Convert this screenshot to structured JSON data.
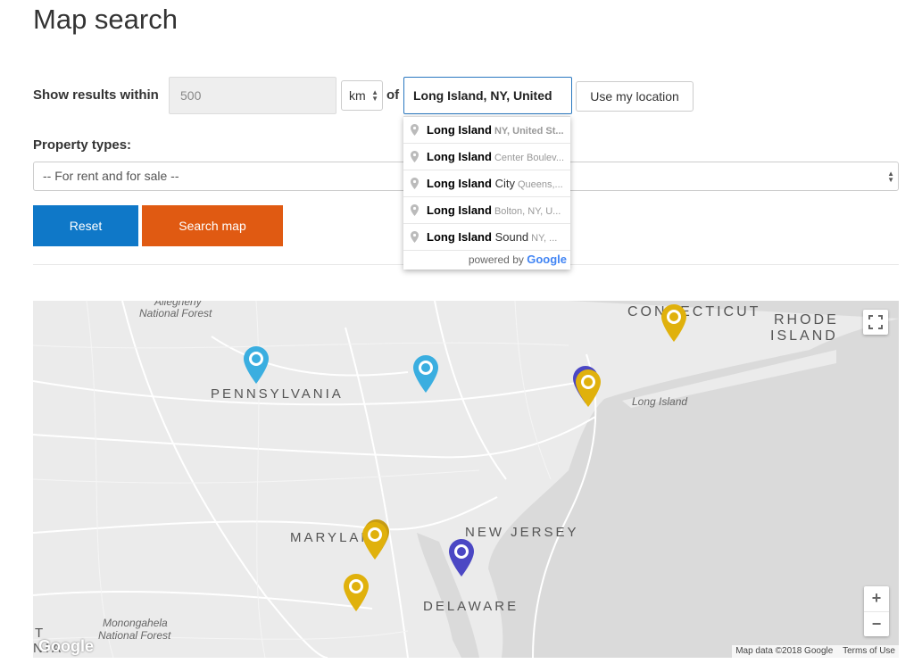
{
  "page": {
    "title": "Map search"
  },
  "search": {
    "show_results_label": "Show results within",
    "radius_placeholder": "500",
    "unit_value": "km",
    "of_label": "of",
    "location_value": "Long Island, NY, United",
    "use_location_label": "Use my location"
  },
  "autocomplete": {
    "items": [
      {
        "main": "Long Island",
        "extra": "",
        "secondary_bold": "NY, United St...",
        "secondary": ""
      },
      {
        "main": "Long Island",
        "extra": "",
        "secondary_bold": "",
        "secondary": "Center Boulev..."
      },
      {
        "main": "Long Island",
        "extra": " City",
        "secondary_bold": "",
        "secondary": "Queens,..."
      },
      {
        "main": "Long Island",
        "extra": "",
        "secondary_bold": "",
        "secondary": "Bolton, NY, U..."
      },
      {
        "main": "Long Island",
        "extra": " Sound",
        "secondary_bold": "",
        "secondary": "NY, ..."
      }
    ],
    "powered_by": "powered by",
    "google": "Google"
  },
  "property": {
    "label": "Property types:",
    "value": "-- For rent and for sale --"
  },
  "buttons": {
    "reset": "Reset",
    "search": "Search map"
  },
  "map": {
    "labels": {
      "connecticut": "CONNECTICUT",
      "rhode_island_1": "RHODE",
      "rhode_island_2": "ISLAND",
      "pennsylvania": "PENNSYLVANIA",
      "maryland": "MARYLAND",
      "new_jersey": "NEW JERSEY",
      "delaware": "DELAWARE",
      "long_island": "Long Island",
      "allegheny_1": "Allegheny",
      "allegheny_2": "National Forest",
      "monongahela_1": "Monongahela",
      "monongahela_2": "National Forest",
      "edge_t": "T",
      "edge_nia": "NIA"
    },
    "pins": [
      {
        "name": "pin-pennsylvania-west",
        "color": "#3aaee0"
      },
      {
        "name": "pin-pennsylvania-east",
        "color": "#3aaee0"
      },
      {
        "name": "pin-nyc-purple",
        "color": "#4b47c4"
      },
      {
        "name": "pin-nyc-gold",
        "color": "#e0b10c"
      },
      {
        "name": "pin-connecticut",
        "color": "#e0b10c"
      },
      {
        "name": "pin-maryland-back",
        "color": "#c79c14"
      },
      {
        "name": "pin-maryland",
        "color": "#e0b10c"
      },
      {
        "name": "pin-new-jersey",
        "color": "#4b47c4"
      },
      {
        "name": "pin-maryland-south",
        "color": "#e0b10c"
      }
    ],
    "zoom_in": "+",
    "zoom_out": "−",
    "attribution_data": "Map data ©2018 Google",
    "terms": "Terms of Use",
    "google_logo": "Google"
  },
  "colors": {
    "primary": "#0f78c8",
    "accent": "#e05a12",
    "pin_blue": "#3aaee0",
    "pin_gold": "#e0b10c",
    "pin_purple": "#4b47c4"
  }
}
